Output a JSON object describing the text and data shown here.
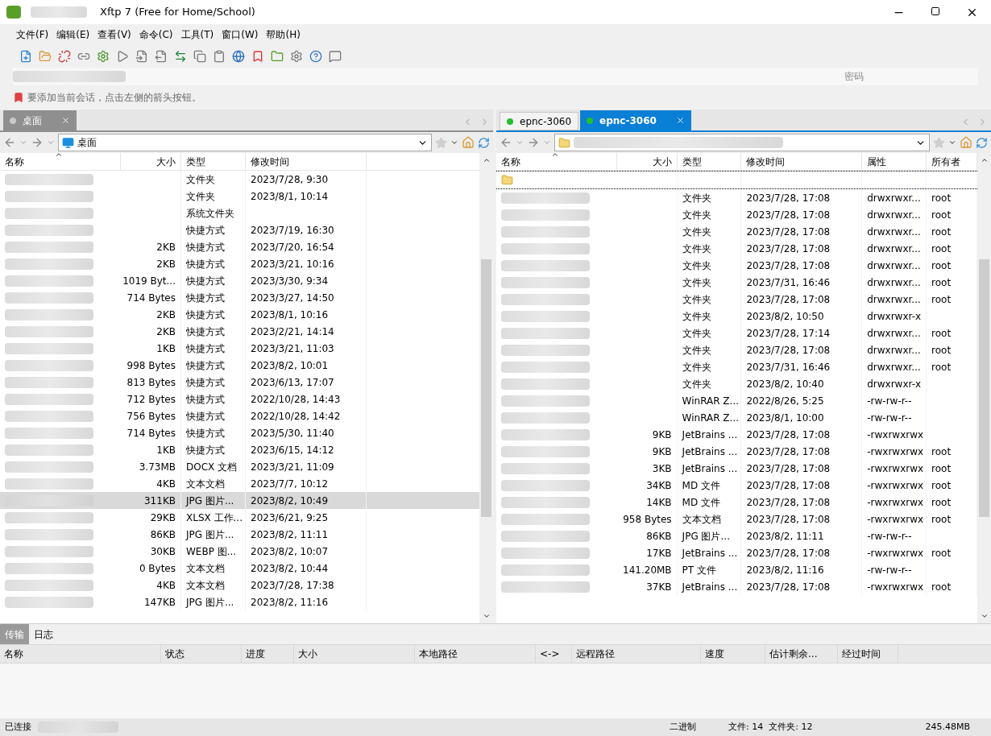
{
  "window": {
    "title": "Xftp 7 (Free for Home/School)"
  },
  "menu": [
    "文件(F)",
    "编辑(E)",
    "查看(V)",
    "命令(C)",
    "工具(T)",
    "窗口(W)",
    "帮助(H)"
  ],
  "address_bar": {
    "password_placeholder": "密码"
  },
  "hint": "要添加当前会话，点击左侧的箭头按钮。",
  "left": {
    "active": false,
    "tabs": [
      {
        "label": "桌面",
        "selected": true,
        "connected": false
      }
    ],
    "path": "桌面",
    "columns": [
      "名称",
      "大小",
      "类型",
      "修改时间"
    ],
    "rows": [
      {
        "size": "",
        "type": "文件夹",
        "modified": "2023/7/28, 9:30",
        "selected": false
      },
      {
        "size": "",
        "type": "文件夹",
        "modified": "2023/8/1, 10:14",
        "selected": false
      },
      {
        "size": "",
        "type": "系统文件夹",
        "modified": "",
        "selected": false
      },
      {
        "size": "",
        "type": "快捷方式",
        "modified": "2023/7/19, 16:30",
        "selected": false
      },
      {
        "size": "2KB",
        "type": "快捷方式",
        "modified": "2023/7/20, 16:54",
        "selected": false
      },
      {
        "size": "2KB",
        "type": "快捷方式",
        "modified": "2023/3/21, 10:16",
        "selected": false
      },
      {
        "size": "1019 Byt...",
        "type": "快捷方式",
        "modified": "2023/3/30, 9:34",
        "selected": false
      },
      {
        "size": "714 Bytes",
        "type": "快捷方式",
        "modified": "2023/3/27, 14:50",
        "selected": false
      },
      {
        "size": "2KB",
        "type": "快捷方式",
        "modified": "2023/8/1, 10:16",
        "selected": false
      },
      {
        "size": "2KB",
        "type": "快捷方式",
        "modified": "2023/2/21, 14:14",
        "selected": false
      },
      {
        "size": "1KB",
        "type": "快捷方式",
        "modified": "2023/3/21, 11:03",
        "selected": false
      },
      {
        "size": "998 Bytes",
        "type": "快捷方式",
        "modified": "2023/8/2, 10:01",
        "selected": false
      },
      {
        "size": "813 Bytes",
        "type": "快捷方式",
        "modified": "2023/6/13, 17:07",
        "selected": false
      },
      {
        "size": "712 Bytes",
        "type": "快捷方式",
        "modified": "2022/10/28, 14:43",
        "selected": false
      },
      {
        "size": "756 Bytes",
        "type": "快捷方式",
        "modified": "2022/10/28, 14:42",
        "selected": false
      },
      {
        "size": "714 Bytes",
        "type": "快捷方式",
        "modified": "2023/5/30, 11:40",
        "selected": false
      },
      {
        "size": "1KB",
        "type": "快捷方式",
        "modified": "2023/6/15, 14:12",
        "selected": false
      },
      {
        "size": "3.73MB",
        "type": "DOCX 文档",
        "modified": "2023/3/21, 11:09",
        "selected": false
      },
      {
        "size": "4KB",
        "type": "文本文档",
        "modified": "2023/7/7, 10:12",
        "selected": false
      },
      {
        "size": "311KB",
        "type": "JPG 图片...",
        "modified": "2023/8/2, 10:49",
        "selected": true
      },
      {
        "size": "29KB",
        "type": "XLSX 工作...",
        "modified": "2023/6/21, 9:25",
        "selected": false
      },
      {
        "size": "86KB",
        "type": "JPG 图片...",
        "modified": "2023/8/2, 11:11",
        "selected": false
      },
      {
        "size": "30KB",
        "type": "WEBP 图...",
        "modified": "2023/8/2, 10:07",
        "selected": false
      },
      {
        "size": "0 Bytes",
        "type": "文本文档",
        "modified": "2023/8/2, 10:44",
        "selected": false
      },
      {
        "size": "4KB",
        "type": "文本文档",
        "modified": "2023/7/28, 17:38",
        "selected": false
      },
      {
        "size": "147KB",
        "type": "JPG 图片...",
        "modified": "2023/8/2, 11:16",
        "selected": false
      }
    ]
  },
  "right": {
    "active": true,
    "tabs": [
      {
        "label": "epnc-3060",
        "selected": false,
        "connected": true
      },
      {
        "label": "epnc-3060",
        "selected": true,
        "connected": true
      }
    ],
    "columns": [
      "名称",
      "大小",
      "类型",
      "修改时间",
      "属性",
      "所有者"
    ],
    "rows": [
      {
        "size": "",
        "type": "",
        "modified": "",
        "attributes": "",
        "owner": ""
      },
      {
        "size": "",
        "type": "文件夹",
        "modified": "2023/7/28, 17:08",
        "attributes": "drwxrwxr...",
        "owner": "root"
      },
      {
        "size": "",
        "type": "文件夹",
        "modified": "2023/7/28, 17:08",
        "attributes": "drwxrwxr...",
        "owner": "root"
      },
      {
        "size": "",
        "type": "文件夹",
        "modified": "2023/7/28, 17:08",
        "attributes": "drwxrwxr...",
        "owner": "root"
      },
      {
        "size": "",
        "type": "文件夹",
        "modified": "2023/7/28, 17:08",
        "attributes": "drwxrwxr...",
        "owner": "root"
      },
      {
        "size": "",
        "type": "文件夹",
        "modified": "2023/7/28, 17:08",
        "attributes": "drwxrwxr...",
        "owner": "root"
      },
      {
        "size": "",
        "type": "文件夹",
        "modified": "2023/7/31, 16:46",
        "attributes": "drwxrwxr...",
        "owner": "root"
      },
      {
        "size": "",
        "type": "文件夹",
        "modified": "2023/7/28, 17:08",
        "attributes": "drwxrwxr...",
        "owner": "root"
      },
      {
        "size": "",
        "type": "文件夹",
        "modified": "2023/8/2, 10:50",
        "attributes": "drwxrwxr-x",
        "owner": ""
      },
      {
        "size": "",
        "type": "文件夹",
        "modified": "2023/7/28, 17:14",
        "attributes": "drwxrwxr...",
        "owner": "root"
      },
      {
        "size": "",
        "type": "文件夹",
        "modified": "2023/7/28, 17:08",
        "attributes": "drwxrwxr...",
        "owner": "root"
      },
      {
        "size": "",
        "type": "文件夹",
        "modified": "2023/7/31, 16:46",
        "attributes": "drwxrwxr...",
        "owner": "root"
      },
      {
        "size": "",
        "type": "文件夹",
        "modified": "2023/8/2, 10:40",
        "attributes": "drwxrwxr-x",
        "owner": ""
      },
      {
        "size": "",
        "type": "WinRAR Z...",
        "modified": "2022/8/26, 5:25",
        "attributes": "-rw-rw-r--",
        "owner": ""
      },
      {
        "size": "",
        "type": "WinRAR Z...",
        "modified": "2023/8/1, 10:00",
        "attributes": "-rw-rw-r--",
        "owner": ""
      },
      {
        "size": "9KB",
        "type": "JetBrains ...",
        "modified": "2023/7/28, 17:08",
        "attributes": "-rwxrwxrwx",
        "owner": ""
      },
      {
        "size": "9KB",
        "type": "JetBrains ...",
        "modified": "2023/7/28, 17:08",
        "attributes": "-rwxrwxrwx",
        "owner": "root"
      },
      {
        "size": "3KB",
        "type": "JetBrains ...",
        "modified": "2023/7/28, 17:08",
        "attributes": "-rwxrwxrwx",
        "owner": "root"
      },
      {
        "size": "34KB",
        "type": "MD 文件",
        "modified": "2023/7/28, 17:08",
        "attributes": "-rwxrwxrwx",
        "owner": "root"
      },
      {
        "size": "14KB",
        "type": "MD 文件",
        "modified": "2023/7/28, 17:08",
        "attributes": "-rwxrwxrwx",
        "owner": "root"
      },
      {
        "size": "958 Bytes",
        "type": "文本文档",
        "modified": "2023/7/28, 17:08",
        "attributes": "-rwxrwxrwx",
        "owner": "root"
      },
      {
        "size": "86KB",
        "type": "JPG 图片...",
        "modified": "2023/8/2, 11:11",
        "attributes": "-rw-rw-r--",
        "owner": ""
      },
      {
        "size": "17KB",
        "type": "JetBrains ...",
        "modified": "2023/7/28, 17:08",
        "attributes": "-rwxrwxrwx",
        "owner": "root"
      },
      {
        "size": "141.20MB",
        "type": "PT 文件",
        "modified": "2023/8/2, 11:16",
        "attributes": "-rw-rw-r--",
        "owner": ""
      },
      {
        "size": "37KB",
        "type": "JetBrains ...",
        "modified": "2023/7/28, 17:08",
        "attributes": "-rwxrwxrwx",
        "owner": "root"
      }
    ]
  },
  "bottom": {
    "tabs": [
      {
        "label": "传输",
        "selected": true
      },
      {
        "label": "日志",
        "selected": false
      }
    ],
    "columns": [
      "名称",
      "状态",
      "进度",
      "大小",
      "本地路径",
      "<->",
      "远程路径",
      "速度",
      "估计剩余...",
      "经过时间"
    ]
  },
  "status_bar": {
    "connection": "已连接",
    "mode": "二进制",
    "counts": "文件: 14  文件夹: 12",
    "total": "245.48MB"
  }
}
